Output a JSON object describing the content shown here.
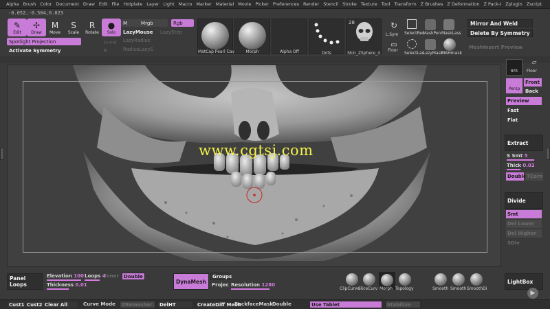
{
  "menu": [
    "Alpha",
    "Brush",
    "Color",
    "Document",
    "Draw",
    "Edit",
    "File",
    "Hotplate",
    "Layer",
    "Light",
    "Macro",
    "Marker",
    "Material",
    "Movie",
    "Picker",
    "Preferences",
    "Render",
    "Stencil",
    "Stroke",
    "Texture",
    "Tool",
    "Transform",
    "Z Brushes",
    "Z Deformation",
    "Z Pack-I",
    "Zplugin",
    "Zscript"
  ],
  "coords": "-0.052,-0.504,0.823",
  "toolbar": {
    "edit": "Edit",
    "draw": "Draw",
    "move": "Move",
    "scale": "Scale",
    "rotate": "Rotate",
    "solo": "Solo",
    "m": "M",
    "mrgb": "Mrgb",
    "rgb": "Rgb",
    "lazy_mouse": "LazyMouse",
    "lazy_step": "LazyStep",
    "lazy_radius": "LazyRadius",
    "lazy_smooth": "RadiusLazyS",
    "spotlight": "Spotlight Projection",
    "activate_symmetry": "Activate Symmetry",
    "dim_1": "I>>V",
    "dim_2": "R",
    "thumbs": [
      {
        "label": "MatCap Pearl Cav"
      },
      {
        "label": "Morph"
      },
      {
        "label": "Alpha Off"
      },
      {
        "label": "Dots"
      },
      {
        "label": "Skin_ZSphere_4",
        "badge": "28"
      }
    ],
    "l_sym": "L.Sym",
    "floor": "Floor",
    "select_rect": "SelectRec",
    "mask_pen": "MaskPen",
    "mask_lasso": "MaskLass",
    "select_lasso": "SelectLas",
    "lazy_mask": "LazyMask",
    "mahmask": "MAHmask",
    "mirror_weld": "Mirror And Weld",
    "delete_symmetry": "Delete By Symmetry",
    "medium_preview": "MeshInsert Preview"
  },
  "watermark": "www.cgtsj.com",
  "right_panel": {
    "bpr": "BPR",
    "floor": "Floor",
    "persp": "Persp",
    "front": "Front",
    "back": "Back",
    "preview": "Preview",
    "fast": "Fast",
    "flat": "Flat",
    "extract": "Extract",
    "s_smt_label": "S Smt",
    "s_smt_value": "5",
    "thick_label": "Thick",
    "thick_value": "0.02",
    "double": "Double",
    "ts_label": "TCorn",
    "divide": "Divide",
    "smt": "Smt",
    "dim_a": "Del Lower",
    "dim_b": "Del Higher",
    "dim_c": "SDiv",
    "lightbox": "LightBox"
  },
  "bottom": {
    "panel_loops": "Panel Loops",
    "elevation_label": "Elevation",
    "elevation_value": "100",
    "loops_label": "Loops",
    "loops_value": "4",
    "inner_label": "Inner",
    "double": "Double",
    "thickness_label": "Thickness",
    "thickness_value": "0.01",
    "dynamesh": "DynaMesh",
    "groups": "Groups",
    "project": "Projec",
    "resolution_label": "Resolution",
    "resolution_value": "1280",
    "brushes": [
      "ClipCurve",
      "SliceCurv",
      "Morph",
      "Topology"
    ],
    "smooths": [
      "Smooth",
      "Smooth",
      "SmoothDi"
    ]
  },
  "status": {
    "cust1": "Cust1",
    "cust2": "Cust2",
    "clear_all": "Clear All",
    "curve_mode": "Curve Mode",
    "dim_button": "ZRemesher",
    "del_hidden": "DelHT",
    "create_diff": "CreateDiff Mesh",
    "backface": "BackfaceMask",
    "double": "Double",
    "use_tablet": "Use Tablet",
    "dim_right": "Stabilize"
  },
  "colors": {
    "accent": "#c97bd8",
    "watermark": "#f4f24a",
    "panel": "#3a3a3a"
  }
}
